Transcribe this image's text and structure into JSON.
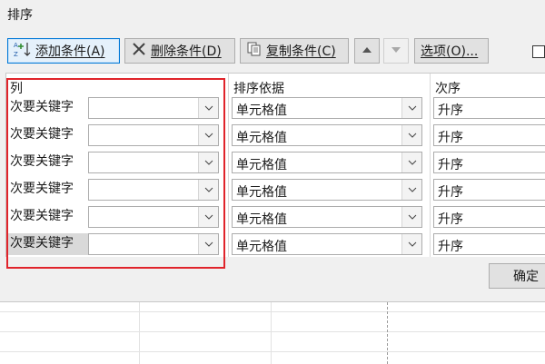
{
  "window": {
    "title": "排序"
  },
  "toolbar": {
    "add_label": "添加条件(A)",
    "delete_label": "删除条件(D)",
    "copy_label": "复制条件(C)",
    "options_label": "选项(O)..."
  },
  "headers": {
    "column": "列",
    "sort_on": "排序依据",
    "order": "次序"
  },
  "rows": [
    {
      "label": "次要关键字",
      "column_value": "",
      "sort_on": "单元格值",
      "order": "升序"
    },
    {
      "label": "次要关键字",
      "column_value": "",
      "sort_on": "单元格值",
      "order": "升序"
    },
    {
      "label": "次要关键字",
      "column_value": "",
      "sort_on": "单元格值",
      "order": "升序"
    },
    {
      "label": "次要关键字",
      "column_value": "",
      "sort_on": "单元格值",
      "order": "升序"
    },
    {
      "label": "次要关键字",
      "column_value": "",
      "sort_on": "单元格值",
      "order": "升序"
    },
    {
      "label": "次要关键字",
      "column_value": "",
      "sort_on": "单元格值",
      "order": "升序"
    }
  ],
  "buttons": {
    "ok": "确定"
  },
  "colors": {
    "highlight": "#e0242b",
    "accent": "#0078d7"
  }
}
